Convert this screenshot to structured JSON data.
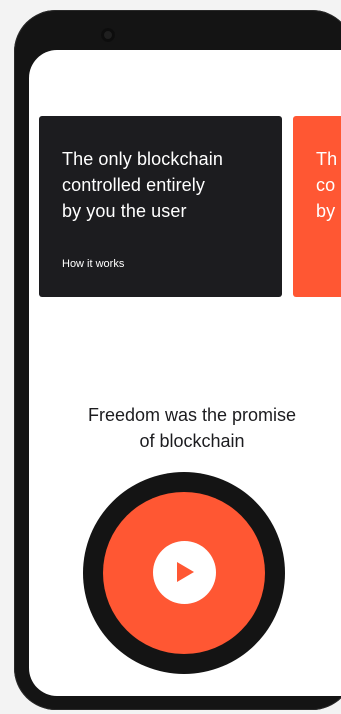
{
  "colors": {
    "accent": "#ff5733",
    "dark": "#1c1c1f",
    "background": "#ffffff"
  },
  "carousel": {
    "cards": [
      {
        "title": "The only blockchain\ncontrolled entirely\nby you the user",
        "link": "How it works"
      },
      {
        "title": "Th\nco\nby"
      }
    ]
  },
  "intro": {
    "tagline": "Freedom was the promise\nof blockchain"
  },
  "video": {
    "icon": "play-icon"
  }
}
